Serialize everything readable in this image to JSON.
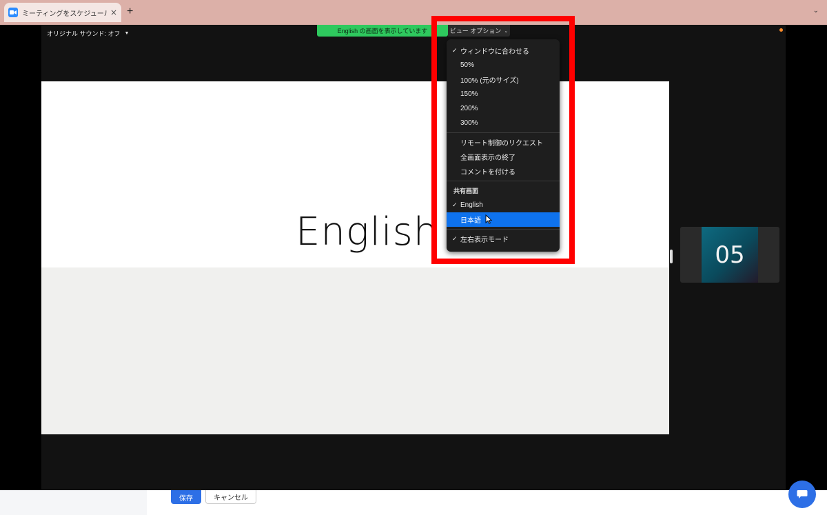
{
  "browser": {
    "tab_title": "ミーティングをスケジュールする",
    "tab_close": "×",
    "new_tab": "+",
    "tab_menu": "⌄"
  },
  "share_toolbar": {
    "original_sound": "オリジナル サウンド: オフ",
    "sharing_banner": "English の画面を表示しています",
    "view_options": "ビュー オプション"
  },
  "slide": {
    "text": "English"
  },
  "participant": {
    "label": "05"
  },
  "view_menu": {
    "zoom_items": [
      {
        "label": "ウィンドウに合わせる",
        "checked": true
      },
      {
        "label": "50%",
        "checked": false
      },
      {
        "label": "100% (元のサイズ)",
        "checked": false
      },
      {
        "label": "150%",
        "checked": false
      },
      {
        "label": "200%",
        "checked": false
      },
      {
        "label": "300%",
        "checked": false
      }
    ],
    "action_items": [
      {
        "label": "リモート制御のリクエスト"
      },
      {
        "label": "全画面表示の終了"
      },
      {
        "label": "コメントを付ける"
      }
    ],
    "shared_screen_header": "共有画面",
    "screen_items": [
      {
        "label": "English",
        "checked": true,
        "highlighted": false
      },
      {
        "label": "日本語",
        "checked": false,
        "highlighted": true
      }
    ],
    "mode_item": {
      "label": "左右表示モード",
      "checked": true
    },
    "check_glyph": "✓"
  },
  "bottom_bar": {
    "save_label": "保存",
    "cancel_label": "キャンセル"
  },
  "colors": {
    "highlight_box": "#ff0000",
    "sharing_banner": "#2ec95e",
    "menu_highlight": "#0e72ed",
    "save_button": "#2d6fe6"
  }
}
